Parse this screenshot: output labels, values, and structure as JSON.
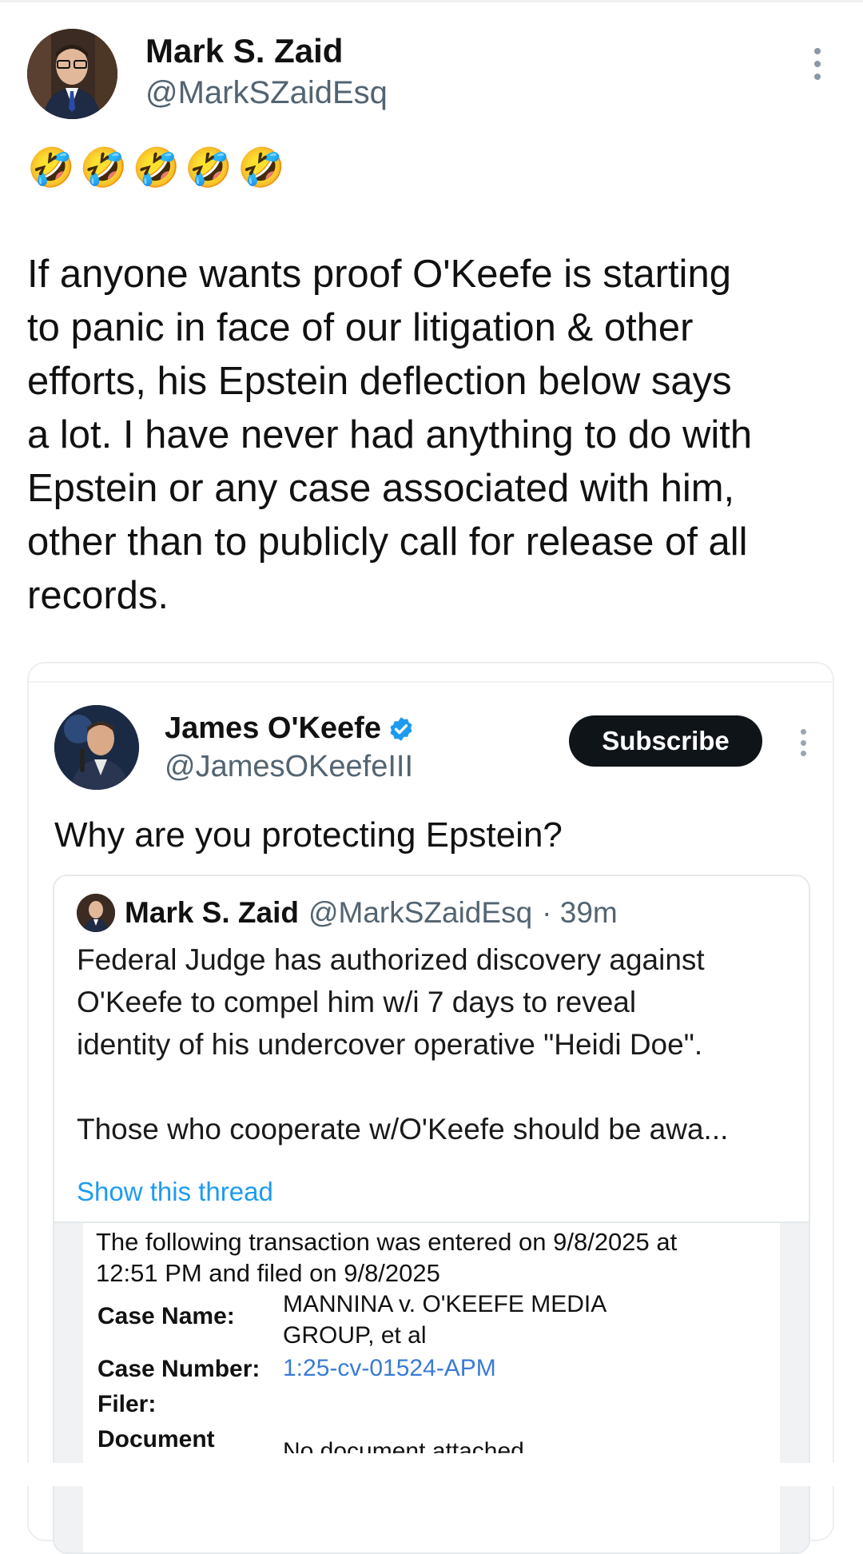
{
  "post": {
    "author_name": "Mark S. Zaid",
    "author_handle": "@MarkSZaidEsq",
    "emojis": [
      "🤣",
      "🤣",
      "🤣",
      "🤣",
      "🤣"
    ],
    "text": "If anyone wants proof O'Keefe is starting\nto panic in face of our litigation & other\nefforts, his Epstein deflection below says\na lot. I have never had anything to do with\nEpstein or any case associated with him,\nother than to publicly call for release of all\nrecords."
  },
  "quote": {
    "author_name": "James O'Keefe",
    "author_handle": "@JamesOKeefeIII",
    "subscribe_label": "Subscribe",
    "text": "Why are you protecting Epstein?",
    "nested": {
      "author_name": "Mark S. Zaid",
      "author_handle": "@MarkSZaidEsq",
      "time": "· 39m",
      "text": "Federal Judge has authorized discovery against\nO'Keefe to compel him w/i 7 days to reveal\nidentity of his undercover operative \"Heidi Doe\".\n\nThose who cooperate w/O'Keefe should be awa...",
      "show_thread": "Show this thread",
      "document": {
        "lead": "The following transaction was entered on 9/8/2025 at\n12:51 PM and filed on 9/8/2025",
        "case_name_label": "Case Name:",
        "case_name_value": "MANNINA v. O'KEEFE MEDIA\nGROUP, et al",
        "case_number_label": "Case Number:",
        "case_number_value": "1:25-cv-01524-APM",
        "filer_label": "Filer:",
        "document_label": "Document",
        "document_value": "No document attached"
      }
    }
  },
  "colors": {
    "accent_link": "#1d9bf0",
    "verified": "#1d9bf0",
    "subscribe_bg": "#0f1419",
    "secondary_text": "#536471"
  },
  "icons": [
    "more-vertical-icon",
    "verified-badge-icon"
  ]
}
